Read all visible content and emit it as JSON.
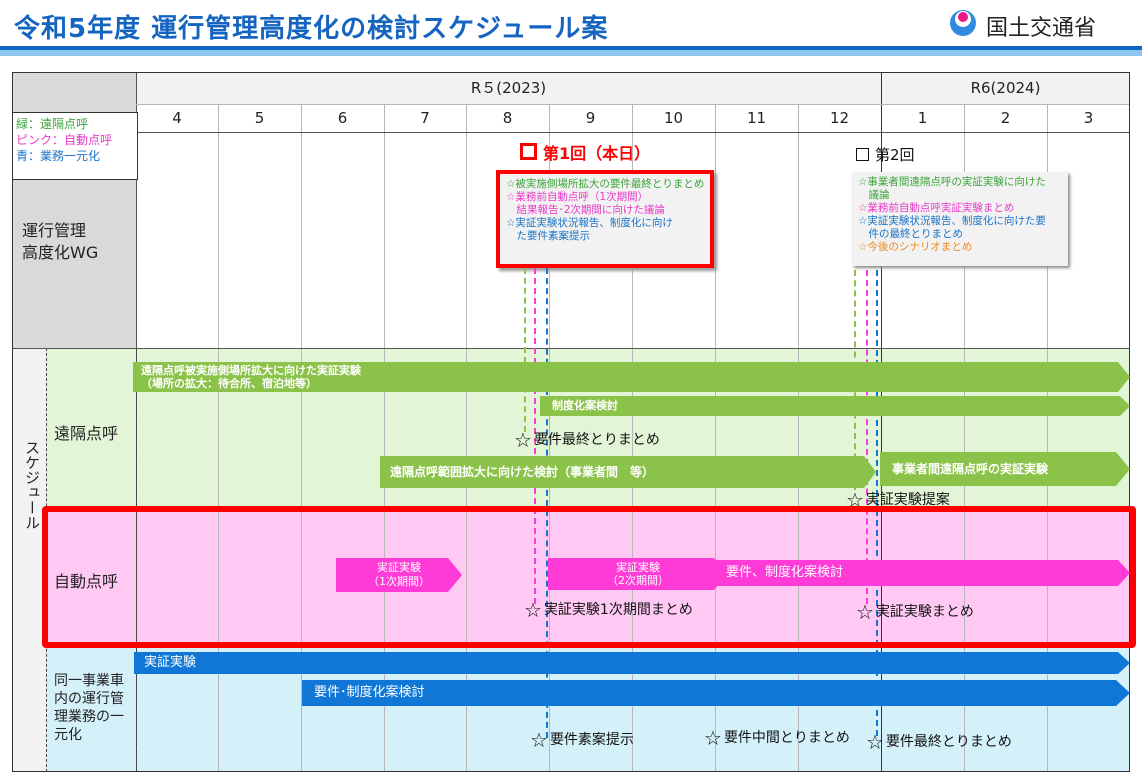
{
  "header": {
    "title": "令和5年度 運行管理高度化の検討スケジュール案",
    "ministry": "国土交通省"
  },
  "colors": {
    "green": "#8bc34a",
    "pink": "#ff3bd7",
    "blue": "#1177d6",
    "red": "#ff0000"
  },
  "years": [
    "R５(2023)",
    "R6(2024)"
  ],
  "months": [
    "4",
    "5",
    "6",
    "7",
    "8",
    "9",
    "10",
    "11",
    "12",
    "1",
    "2",
    "3"
  ],
  "legend": [
    "緑：遠隔点呼",
    "ピンク：自動点呼",
    "青：業務一元化"
  ],
  "wg": {
    "label": "運行管理\n高度化WG",
    "meeting1": "第1回（本日）",
    "meeting2": "第2回",
    "note1": [
      "☆被実施側場所拡大の要件最終とりまとめ",
      "☆業務前自動点呼（1次期間）",
      "　結果報告･2次期間に向けた議論",
      "☆実証実験状況報告、制度化に向け",
      "　た要件素案提示"
    ],
    "note2": [
      "☆事業者間遠隔点呼の実証実験に向けた",
      "　議論",
      "☆業務前自動点呼実証実験まとめ",
      "☆実証実験状況報告、制度化に向けた要",
      "　件の最終とりまとめ",
      "☆今後のシナリオまとめ"
    ]
  },
  "schedule_label": "スケジュール",
  "remote": {
    "label": "遠隔点呼",
    "bar1_line1": "遠隔点呼被実施側場所拡大に向けた実証実験",
    "bar1_line2": "（場所の拡大：待合所、宿泊地等）",
    "bar2": "制度化案検討",
    "bar3": "遠隔点呼範囲拡大に向けた検討（事業者間　等）",
    "bar4": "事業者間遠隔点呼の実証実験",
    "star1": "要件最終とりまとめ",
    "star2": "実証実験提案"
  },
  "auto": {
    "label": "自動点呼",
    "bar1_line1": "実証実験",
    "bar1_line2": "（1次期間）",
    "bar2_line1": "実証実験",
    "bar2_line2": "（2次期間）",
    "bar3": "要件、制度化案検討",
    "star1": "実証実験1次期間まとめ",
    "star2": "実証実験まとめ"
  },
  "unify": {
    "label": "同一事業車\n内の運行管\n理業務の一\n元化",
    "bar1": "実証実験",
    "bar2": "要件･制度化案検討",
    "star1": "要件素案提示",
    "star2": "要件中間とりまとめ",
    "star3": "要件最終とりまとめ"
  },
  "star_glyph": "☆"
}
